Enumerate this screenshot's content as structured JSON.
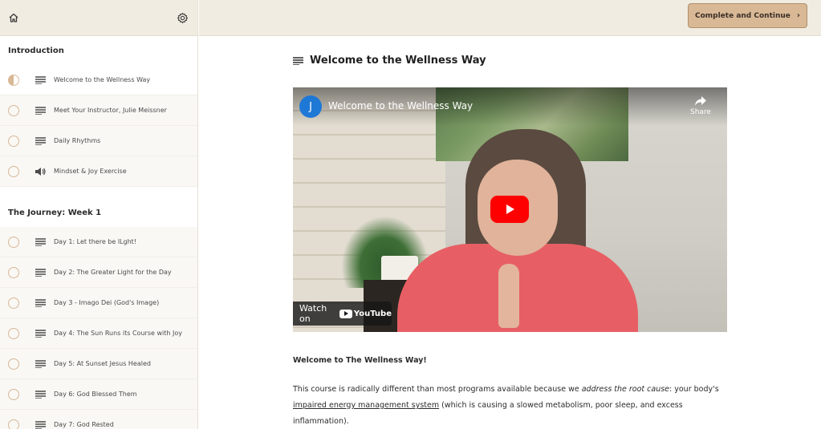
{
  "sidebar": {
    "sections": [
      {
        "title": "Introduction",
        "lessons": [
          {
            "label": "Welcome to the Wellness Way",
            "type": "text",
            "status": "in-progress"
          },
          {
            "label": "Meet Your Instructor, Julie Meissner",
            "type": "text",
            "status": "not-started"
          },
          {
            "label": "Daily Rhythms",
            "type": "text",
            "status": "not-started"
          },
          {
            "label": "Mindset & Joy Exercise",
            "type": "audio",
            "status": "not-started"
          }
        ]
      },
      {
        "title": "The Journey: Week 1",
        "lessons": [
          {
            "label": "Day 1: Let there be lLght!",
            "type": "text",
            "status": "not-started"
          },
          {
            "label": "Day 2: The Greater Light for the Day",
            "type": "text",
            "status": "not-started"
          },
          {
            "label": "Day 3 - Imago Dei (God's Image)",
            "type": "text",
            "status": "not-started"
          },
          {
            "label": "Day 4: The Sun Runs its Course with Joy",
            "type": "text",
            "status": "not-started"
          },
          {
            "label": "Day 5: At Sunset Jesus Healed",
            "type": "text",
            "status": "not-started"
          },
          {
            "label": "Day 6: God Blessed Them",
            "type": "text",
            "status": "not-started"
          },
          {
            "label": "Day 7: God Rested",
            "type": "text",
            "status": "not-started"
          }
        ]
      }
    ],
    "icons": {
      "home": "home-icon",
      "settings": "gear-icon"
    }
  },
  "topbar": {
    "complete_label": "Complete and Continue",
    "complete_icon": "chevron-right-icon"
  },
  "lesson": {
    "title": "Welcome to the Wellness Way",
    "video": {
      "channel_initial": "J",
      "title": "Welcome to the Wellness Way",
      "share_label": "Share",
      "watch_on_label": "Watch on",
      "youtube_label": "YouTube"
    },
    "body": {
      "heading": "Welcome to The Wellness Way!",
      "p1_part1": "This course is radically different than most programs available because we ",
      "p1_em": "address the root cause",
      "p1_part2": ": your body's ",
      "p1_link": "impaired energy management system",
      "p1_part3": " (which is causing a slowed metabolism, poor sleep, and excess inflammation)."
    }
  },
  "colors": {
    "topbar_bg": "#f1ece1",
    "accent": "#d9b896",
    "youtube_red": "#ff0000"
  }
}
